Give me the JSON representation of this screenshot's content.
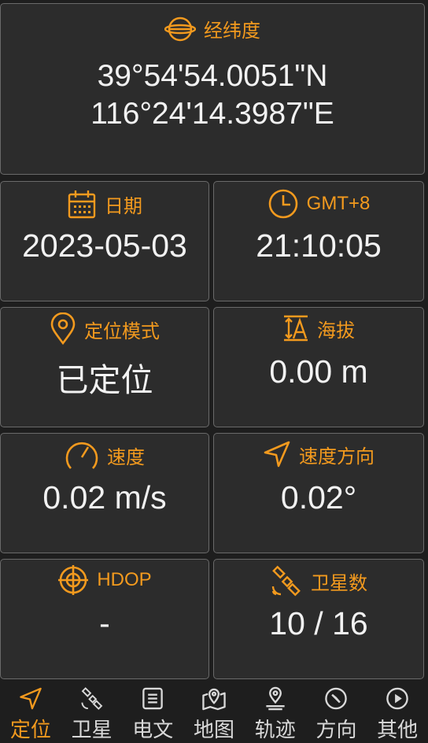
{
  "colors": {
    "accent": "#f39a1e",
    "card_bg": "#2c2c2c",
    "card_border": "#6a6a6a",
    "page_bg": "#1e1e1e",
    "text": "#f2f2f2"
  },
  "coordinates": {
    "label": "经纬度",
    "icon": "globe-icon",
    "latitude": "39°54'54.0051\"N",
    "longitude": "116°24'14.3987\"E"
  },
  "date": {
    "label": "日期",
    "icon": "calendar-icon",
    "value": "2023-05-03"
  },
  "time": {
    "label": "GMT+8",
    "icon": "clock-icon",
    "value": "21:10:05"
  },
  "fix_mode": {
    "label": "定位模式",
    "icon": "location-pin-icon",
    "value": "已定位"
  },
  "altitude": {
    "label": "海拔",
    "icon": "altitude-icon",
    "value": "0.00 m"
  },
  "speed": {
    "label": "速度",
    "icon": "speedometer-icon",
    "value": "0.02 m/s"
  },
  "heading": {
    "label": "速度方向",
    "icon": "navigation-arrow-icon",
    "value": "0.02°"
  },
  "hdop": {
    "label": "HDOP",
    "icon": "crosshair-icon",
    "value": "-"
  },
  "satellites": {
    "label": "卫星数",
    "icon": "satellite-icon",
    "value": "10 / 16"
  },
  "nav": {
    "items": [
      {
        "label": "定位",
        "icon": "navigation-arrow-icon",
        "active": true
      },
      {
        "label": "卫星",
        "icon": "satellite-icon"
      },
      {
        "label": "电文",
        "icon": "document-icon"
      },
      {
        "label": "地图",
        "icon": "map-icon"
      },
      {
        "label": "轨迹",
        "icon": "track-pin-icon"
      },
      {
        "label": "方向",
        "icon": "compass-icon"
      },
      {
        "label": "其他",
        "icon": "play-circle-icon"
      }
    ]
  }
}
